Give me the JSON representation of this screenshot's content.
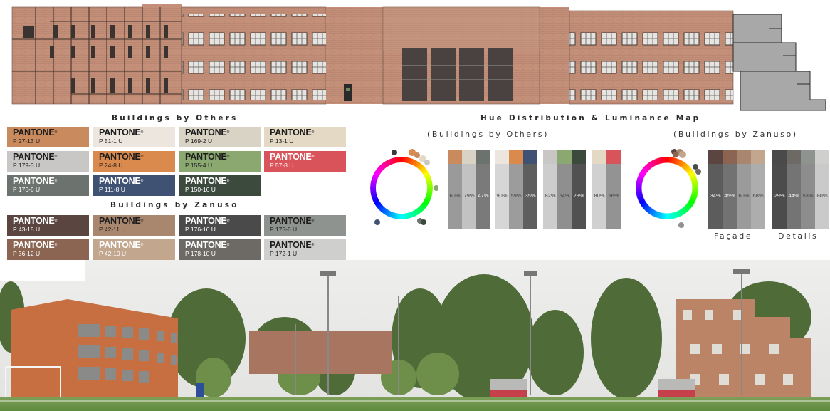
{
  "headings": {
    "others": "Buildings by Others",
    "zanuso": "Buildings by Zanuso",
    "hue_map": "Hue Distribution & Luminance Map",
    "hue_others": "(Buildings by Others)",
    "hue_zanuso": "(Buildings by Zanuso)"
  },
  "brand_word": "PANTONE",
  "swatches_others": [
    {
      "code": "P 27-13 U",
      "color": "#c98a5e",
      "text": "#1d1d1d"
    },
    {
      "code": "P 51-1 U",
      "color": "#ede6df",
      "text": "#1d1d1d"
    },
    {
      "code": "P 169-2 U",
      "color": "#d9d3c6",
      "text": "#1d1d1d"
    },
    {
      "code": "P 13-1 U",
      "color": "#e4d9c5",
      "text": "#1d1d1d"
    },
    {
      "code": "P 179-3 U",
      "color": "#c9c7c5",
      "text": "#1d1d1d"
    },
    {
      "code": "P 24-8 U",
      "color": "#db8a4e",
      "text": "#1d1d1d"
    },
    {
      "code": "P 155-4 U",
      "color": "#8aa870",
      "text": "#1d1d1d"
    },
    {
      "code": "P 57-8 U",
      "color": "#d9535a",
      "text": "#ffffff"
    },
    {
      "code": "P 176-6 U",
      "color": "#6c726e",
      "text": "#ffffff"
    },
    {
      "code": "P 111-8 U",
      "color": "#3f5273",
      "text": "#ffffff"
    },
    {
      "code": "P 150-16 U",
      "color": "#3c4a3e",
      "text": "#ffffff"
    }
  ],
  "swatches_zanuso": [
    {
      "code": "P 43-15 U",
      "color": "#5a4540",
      "text": "#ffffff"
    },
    {
      "code": "P 42-11 U",
      "color": "#a9876f",
      "text": "#1d1d1d"
    },
    {
      "code": "P 176-16 U",
      "color": "#4a4a4a",
      "text": "#ffffff"
    },
    {
      "code": "P 175-6 U",
      "color": "#8e938f",
      "text": "#1d1d1d"
    },
    {
      "code": "P 36-12 U",
      "color": "#8c6452",
      "text": "#ffffff"
    },
    {
      "code": "P 42-10 U",
      "color": "#c3a68e",
      "text": "#ffffff"
    },
    {
      "code": "P 178-10 U",
      "color": "#6d6a66",
      "text": "#ffffff"
    },
    {
      "code": "P 172-1 U",
      "color": "#cfcfcd",
      "text": "#1d1d1d"
    }
  ],
  "luminance_others": [
    {
      "top": "#c98a5e",
      "lum": "#9a9a9a",
      "pct": "60%"
    },
    {
      "top": "#d9d3c6",
      "lum": "#c2c2c2",
      "pct": "79%"
    },
    {
      "top": "#6c726e",
      "lum": "#7a7a7a",
      "pct": "47%"
    },
    {
      "top": "#ede6df",
      "lum": "#d6d6d6",
      "pct": "90%"
    },
    {
      "top": "#db8a4e",
      "lum": "#9c9c9c",
      "pct": "59%"
    },
    {
      "top": "#3f5273",
      "lum": "#5e5e5e",
      "pct": "35%"
    },
    {
      "top": "#c9c7c5",
      "lum": "#cdcdcd",
      "pct": "82%"
    },
    {
      "top": "#8aa870",
      "lum": "#8f8f8f",
      "pct": "54%"
    },
    {
      "top": "#3c4a3e",
      "lum": "#515151",
      "pct": "29%"
    },
    {
      "top": "#e4d9c5",
      "lum": "#d0d0d0",
      "pct": "80%"
    },
    {
      "top": "#d9535a",
      "lum": "#939393",
      "pct": "56%"
    }
  ],
  "luminance_zanuso": [
    {
      "top": "#5a4540",
      "lum": "#5c5c5c",
      "pct": "34%"
    },
    {
      "top": "#8c6452",
      "lum": "#727272",
      "pct": "45%"
    },
    {
      "top": "#a9876f",
      "lum": "#9b9b9b",
      "pct": "60%"
    },
    {
      "top": "#c3a68e",
      "lum": "#adadad",
      "pct": "68%"
    },
    {
      "top": "#4a4a4a",
      "lum": "#4c4c4c",
      "pct": "29%"
    },
    {
      "top": "#6d6a66",
      "lum": "#747474",
      "pct": "44%"
    },
    {
      "top": "#8e938f",
      "lum": "#8d8d8d",
      "pct": "53%"
    },
    {
      "top": "#cfcfcd",
      "lum": "#cacaca",
      "pct": "80%"
    }
  ],
  "labels": {
    "facade": "Façade",
    "details": "Details"
  }
}
